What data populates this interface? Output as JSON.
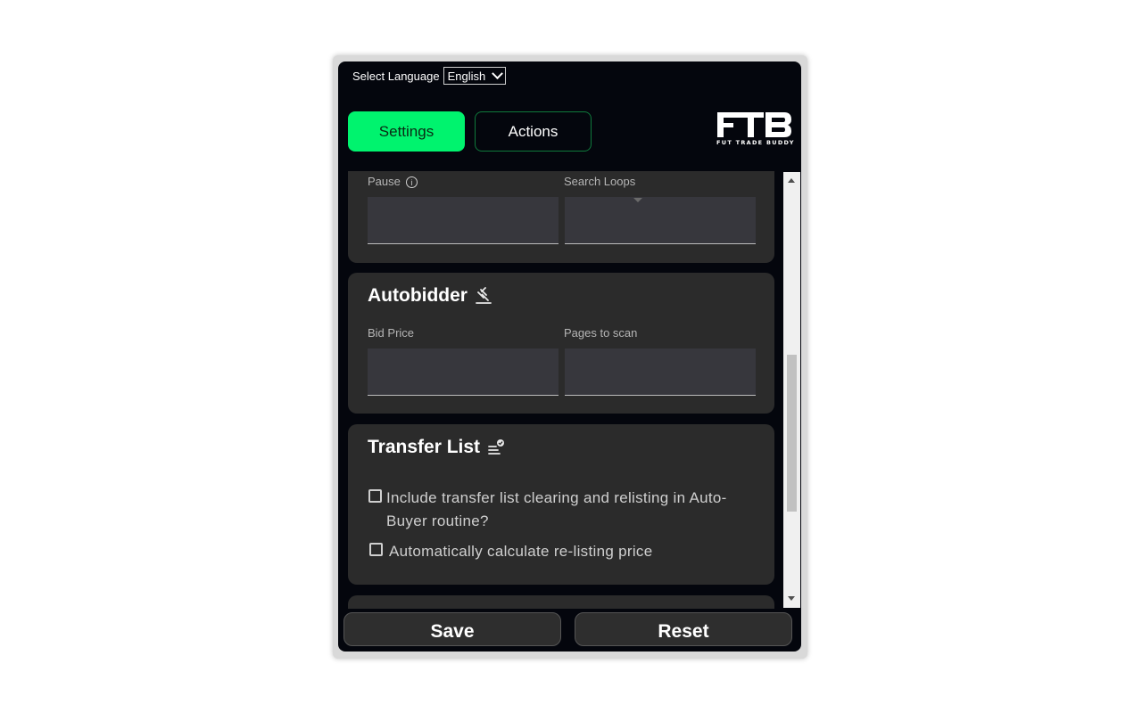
{
  "language": {
    "label": "Select Language",
    "selected": "English"
  },
  "tabs": [
    {
      "label": "Settings",
      "active": true
    },
    {
      "label": "Actions",
      "active": false
    }
  ],
  "logo": {
    "mark": "FTB",
    "tagline": "FUT TRADE BUDDY"
  },
  "search_section": {
    "pause_label": "Pause",
    "pause_info_icon": "info-icon",
    "search_loops_label": "Search Loops"
  },
  "autobidder": {
    "title": "Autobidder",
    "icon": "gavel-icon",
    "bid_price_label": "Bid Price",
    "pages_label": "Pages to scan"
  },
  "transfer_list": {
    "title": "Transfer List",
    "icon": "list-check-icon",
    "options": [
      {
        "label": "Include transfer list clearing and relisting in Auto-Buyer routine?",
        "checked": false
      },
      {
        "label": "Automatically calculate re-listing price",
        "checked": false
      }
    ]
  },
  "footer": {
    "save_label": "Save",
    "reset_label": "Reset"
  },
  "colors": {
    "accent": "#00f36e",
    "background": "#04060d",
    "card": "#2b2b2b"
  }
}
